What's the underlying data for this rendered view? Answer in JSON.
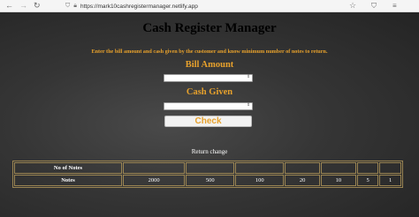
{
  "browser": {
    "back_icon": "←",
    "forward_icon": "→",
    "reload_icon": "↻",
    "url": "https://mark10cashregistermanager.netlify.app",
    "bookmark_icon": "☆"
  },
  "app": {
    "title": "Cash Register Manager",
    "instructions": "Enter the bill amount and cash given by the customer and know minimum number of notes to return.",
    "bill_label": "Bill Amount",
    "bill_value": "",
    "cash_label": "Cash Given",
    "cash_value": "",
    "check_label": "Check",
    "return_label": "Return change",
    "table": {
      "row1_header": "No of Notes",
      "row2_header": "Notes",
      "no_of_notes": [
        "",
        "",
        "",
        "",
        "",
        "",
        ""
      ],
      "notes": [
        "2000",
        "500",
        "100",
        "20",
        "10",
        "5",
        "1"
      ]
    }
  },
  "colors": {
    "accent": "#e7a12c",
    "background": "#2a2a2a",
    "table_border": "#9a8452"
  }
}
